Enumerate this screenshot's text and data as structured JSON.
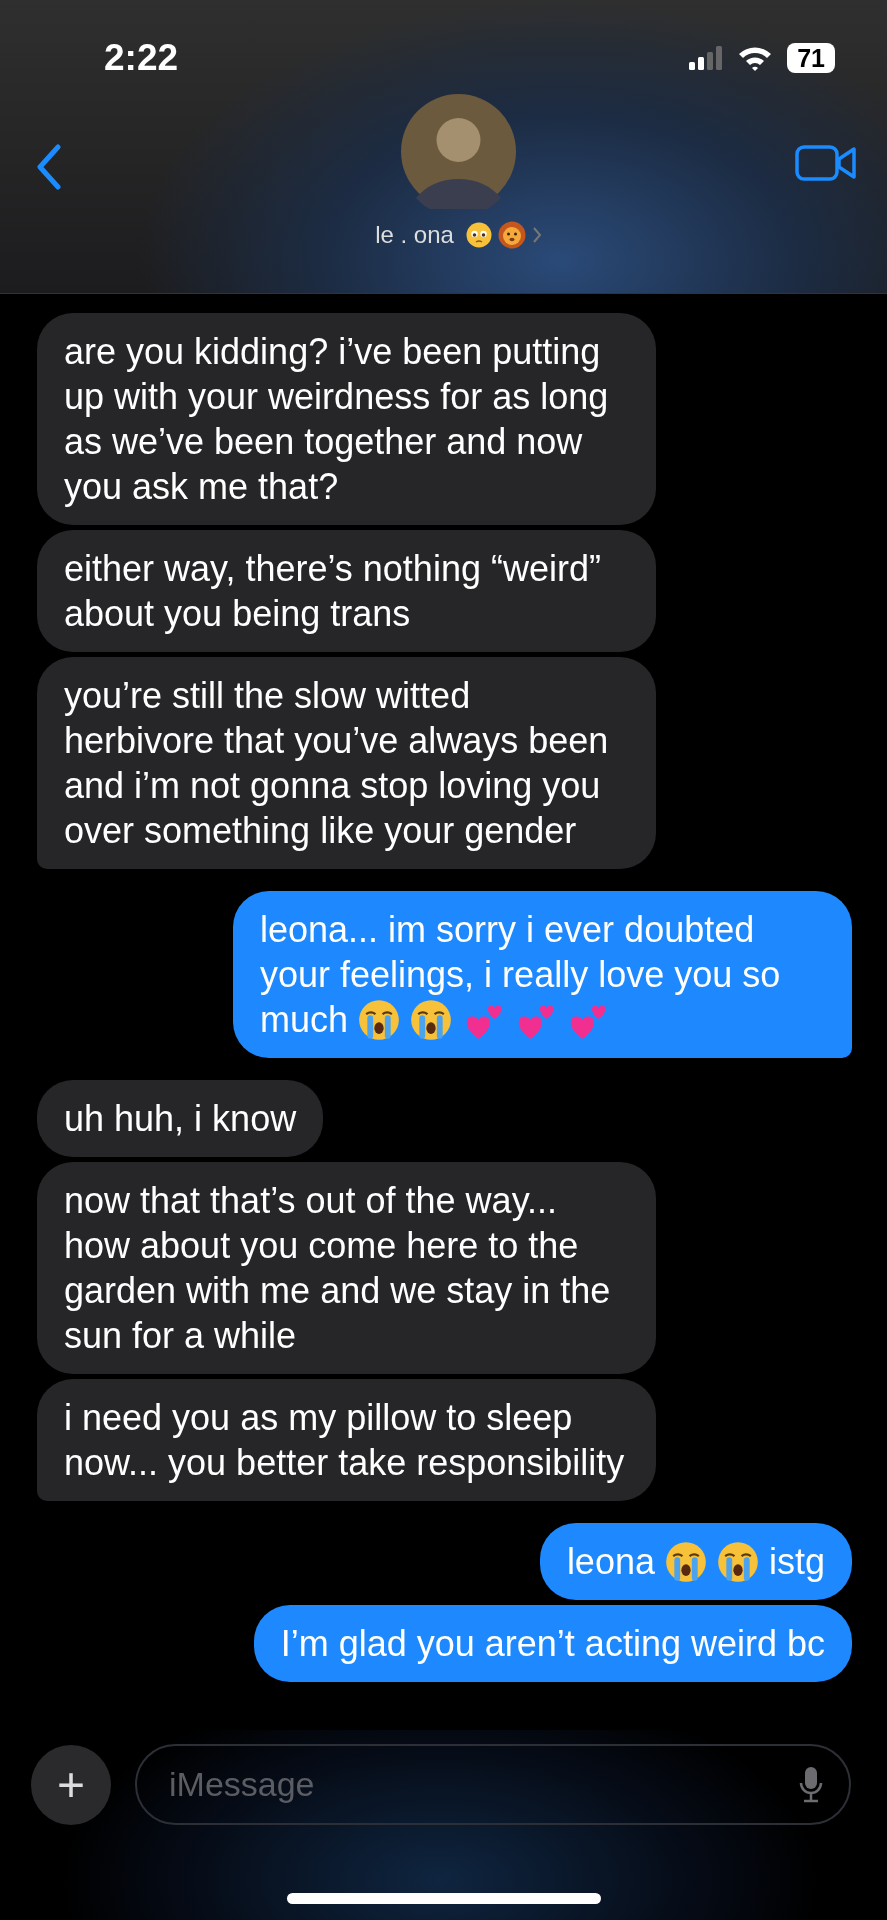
{
  "status_bar": {
    "time": "2:22",
    "battery": "71"
  },
  "header": {
    "name": "le . ona",
    "name_emoji": [
      {
        "kind": "pleading"
      },
      {
        "kind": "lion"
      }
    ]
  },
  "messages": [
    {
      "kind": "incoming",
      "tail": false,
      "parts": [
        {
          "kind": "text",
          "text": "are you kidding? i’ve been putting up with your weirdness for as long as we’ve been together and now you ask me that?"
        }
      ]
    },
    {
      "kind": "incoming",
      "tail": false,
      "parts": [
        {
          "kind": "text",
          "text": "either way, there’s nothing “weird” about you being trans"
        }
      ]
    },
    {
      "kind": "incoming",
      "tail": true,
      "parts": [
        {
          "kind": "text",
          "text": "you’re still the slow witted herbivore that you’ve always been and i’m not gonna stop loving you over something like your gender"
        }
      ]
    },
    {
      "kind": "outgoing",
      "tail": true,
      "parts": [
        {
          "kind": "text",
          "text": "leona... im sorry i ever doubted your feelings, i really love you so"
        },
        {
          "kind": "text",
          "text": "much"
        },
        {
          "kind": "sob"
        },
        {
          "kind": "sob"
        },
        {
          "kind": "hearts"
        },
        {
          "kind": "hearts"
        },
        {
          "kind": "hearts"
        }
      ]
    },
    {
      "kind": "incoming",
      "tail": false,
      "parts": [
        {
          "kind": "text",
          "text": "uh huh, i know"
        }
      ]
    },
    {
      "kind": "incoming",
      "tail": false,
      "parts": [
        {
          "kind": "text",
          "text": "now that that’s out of the way... how about you come here to the garden with me and we stay in the sun for a while"
        }
      ]
    },
    {
      "kind": "incoming",
      "tail": true,
      "parts": [
        {
          "kind": "text",
          "text": "i need you as my pillow to sleep now... you better take responsibility"
        }
      ]
    },
    {
      "kind": "outgoing",
      "tail": false,
      "parts": [
        {
          "kind": "text",
          "text": "leona"
        },
        {
          "kind": "sob"
        },
        {
          "kind": "sob"
        },
        {
          "kind": "text",
          "text": "istg"
        }
      ]
    },
    {
      "kind": "outgoing",
      "tail": false,
      "parts": [
        {
          "kind": "text",
          "text": "I’m glad you aren’t acting weird bc"
        }
      ]
    }
  ],
  "composer": {
    "plus": "+",
    "placeholder": "iMessage"
  }
}
